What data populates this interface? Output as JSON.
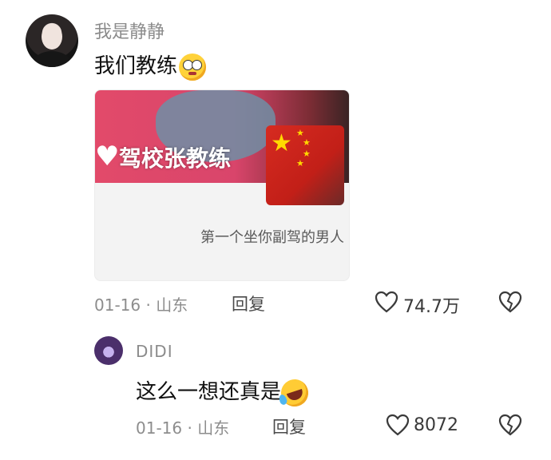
{
  "comment": {
    "username": "我是静静",
    "text": "我们教练",
    "emoji": "flushed-face",
    "card": {
      "banner_text": "驾校张教练",
      "caption": "第一个坐你副驾的男人"
    },
    "date": "01-16",
    "separator": "·",
    "location": "山东",
    "reply_label": "回复",
    "likes": "74.7万"
  },
  "reply": {
    "username": "DIDI",
    "text": "这么一想还真是",
    "emoji": "rolling-on-floor-laughing",
    "date": "01-16",
    "separator": "·",
    "location": "山东",
    "reply_label": "回复",
    "likes": "8072"
  },
  "colors": {
    "like_icon": "#3a3a3a",
    "meta_text": "#8d8d8d",
    "card_banner": "#e24a6a"
  }
}
